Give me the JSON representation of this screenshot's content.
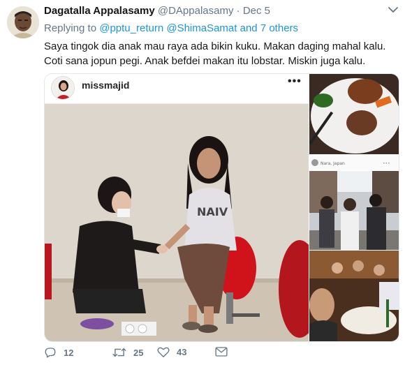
{
  "author": {
    "name": "Dagatalla Appalasamy",
    "handle": "@DAppalasamy",
    "separator": "·",
    "date": "Dec 5"
  },
  "reply": {
    "prefix": "Replying to",
    "mention1": "@pptu_return",
    "mention2": "@ShimaSamat",
    "conjunction": "and",
    "others": "7 others"
  },
  "tweet_text": "Saya tingok dia anak mau raya ada bikin kuku. Makan daging mahal kalu. Coti sana jopun pegi. Anak befdei makan itu lobstar. Miskin juga kalu.",
  "instagram": {
    "username": "missmajid",
    "more": "•••",
    "location_label": "Nara, Japan"
  },
  "actions": {
    "replies": "12",
    "retweets": "25",
    "likes": "43"
  },
  "icons": [
    "chevron-down-icon",
    "reply-icon",
    "retweet-icon",
    "like-icon",
    "share-icon"
  ],
  "colors": {
    "link": "#1b95e0",
    "muted": "#657786",
    "text": "#14171a"
  }
}
